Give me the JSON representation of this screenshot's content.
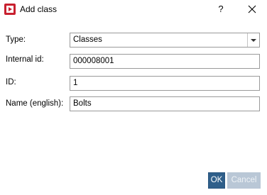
{
  "window": {
    "title": "Add class",
    "help_label": "?"
  },
  "form": {
    "type": {
      "label": "Type:",
      "value": "Classes"
    },
    "internal_id": {
      "label": "Internal id:",
      "value": "000008001"
    },
    "id": {
      "label": "ID:",
      "value": "1"
    },
    "name": {
      "label": "Name (english):",
      "value": "Bolts"
    }
  },
  "buttons": {
    "ok": "OK",
    "cancel": "Cancel"
  }
}
